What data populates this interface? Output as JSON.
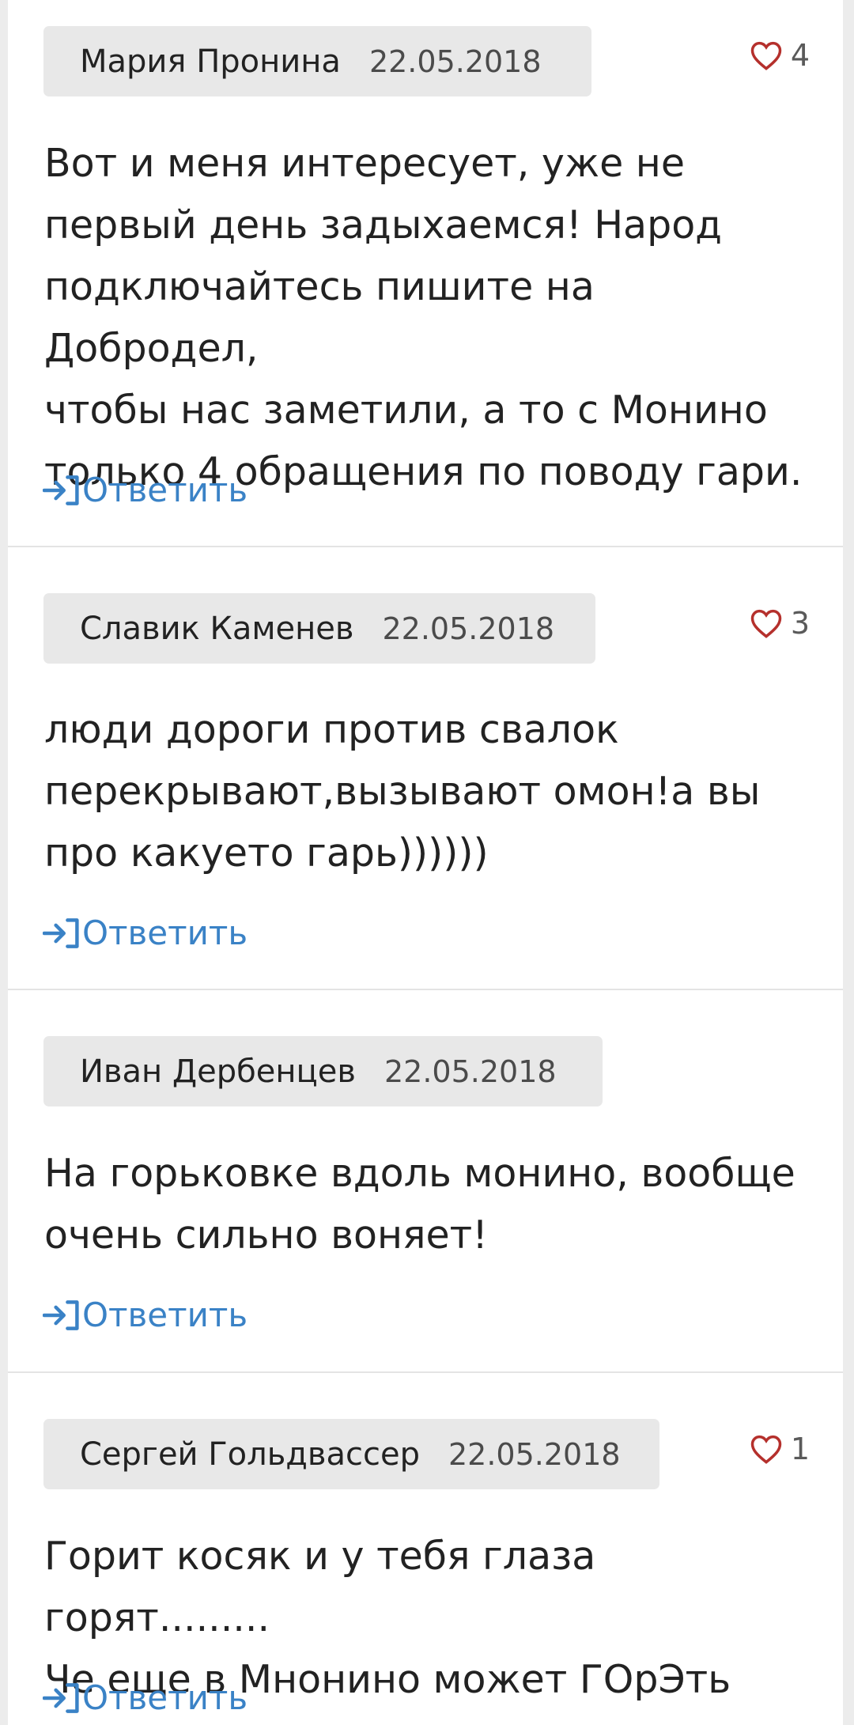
{
  "comments": [
    {
      "author": "Мария Пронина",
      "date": "22.05.2018",
      "likes": "4",
      "text": "Вот и меня интересует, уже не\nпервый день задыхаемся! Народ\nподключайтесь пишите на Добродел,\nчтобы нас заметили, а то с Монино\nтолько 4 обращения по поводу гари.",
      "reply_label": "Ответить"
    },
    {
      "author": "Славик Каменев",
      "date": "22.05.2018",
      "likes": "3",
      "text": "люди дороги против свалок\nперекрывают,вызывают омон!а вы\nпро какуето гарь))))))",
      "reply_label": "Ответить"
    },
    {
      "author": "Иван Дербенцев",
      "date": "22.05.2018",
      "likes": null,
      "text": "На горьковке вдоль монино, вообще\nочень сильно воняет!",
      "reply_label": "Ответить"
    },
    {
      "author": "Сергей Гольдвассер",
      "date": "22.05.2018",
      "likes": "1",
      "text": "Горит косяк и у тебя глаза горят.........\nЧе еще в Мнонино может ГОрЭть",
      "reply_label": "Ответить"
    }
  ],
  "colors": {
    "reply_link": "#3a82c6",
    "heart": "#b5302c",
    "meta_bg": "#e8e8e8"
  },
  "icons": {
    "like": "heart-outline-icon",
    "reply": "reply-arrow-icon"
  }
}
